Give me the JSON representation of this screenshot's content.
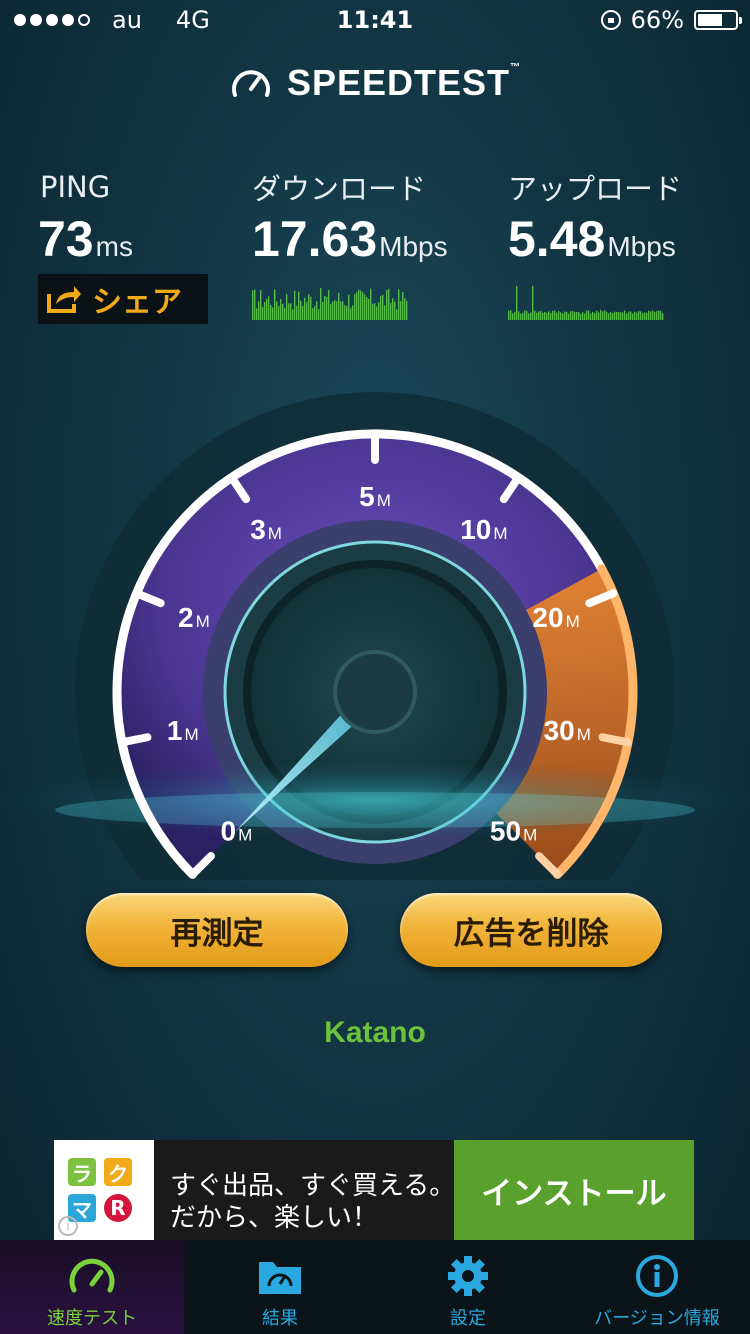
{
  "status_bar": {
    "carrier": "au",
    "network": "4G",
    "time": "11:41",
    "battery_percent": "66%",
    "battery_level": 0.66,
    "signal_bars": 4
  },
  "app": {
    "logo_title": "SPEEDTEST",
    "trademark": "™"
  },
  "results": {
    "ping": {
      "label": "PING",
      "value": "73",
      "unit": "ms"
    },
    "download": {
      "label": "ダウンロード",
      "value": "17.63",
      "unit": "Mbps"
    },
    "upload": {
      "label": "アップロード",
      "value": "5.48",
      "unit": "Mbps"
    },
    "share_label": "シェア"
  },
  "gauge": {
    "scale_labels": [
      {
        "value": "0",
        "unit": "M"
      },
      {
        "value": "1",
        "unit": "M"
      },
      {
        "value": "2",
        "unit": "M"
      },
      {
        "value": "3",
        "unit": "M"
      },
      {
        "value": "5",
        "unit": "M"
      },
      {
        "value": "10",
        "unit": "M"
      },
      {
        "value": "20",
        "unit": "M"
      },
      {
        "value": "30",
        "unit": "M"
      },
      {
        "value": "50",
        "unit": "M"
      }
    ],
    "needle_value": "0"
  },
  "buttons": {
    "retest": "再測定",
    "remove_ads": "広告を削除"
  },
  "server_name": "Katano",
  "ad": {
    "icon_chars": [
      "ラ",
      "ク",
      "マ",
      "R"
    ],
    "text_line1": "すぐ出品、すぐ買える。",
    "text_line2": "だから、楽しい！",
    "install_label": "インストール",
    "info_symbol": "i"
  },
  "tabbar": {
    "items": [
      {
        "label": "速度テスト",
        "icon": "speedometer-icon",
        "active": true
      },
      {
        "label": "結果",
        "icon": "results-folder-icon",
        "active": false
      },
      {
        "label": "設定",
        "icon": "gear-icon",
        "active": false
      },
      {
        "label": "バージョン情報",
        "icon": "info-icon",
        "active": false
      }
    ]
  },
  "colors": {
    "accent_orange": "#f2a91a",
    "server_green": "#6cc23a",
    "tab_active": "#79d23a",
    "tab_inactive": "#29a9e0",
    "gauge_purple": "#5b3fa0",
    "gauge_fill_orange": "#e07a1c"
  }
}
